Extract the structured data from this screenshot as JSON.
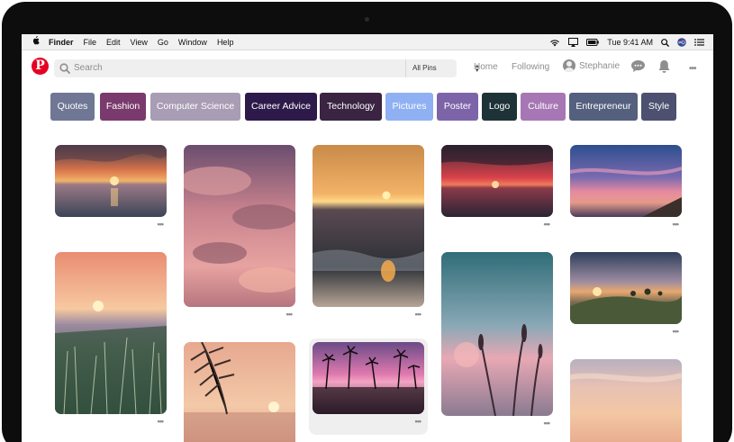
{
  "menubar": {
    "app_name": "Finder",
    "menus": [
      "File",
      "Edit",
      "View",
      "Go",
      "Window",
      "Help"
    ],
    "clock": "Tue 9:41 AM"
  },
  "header": {
    "logo_letter": "P",
    "search_placeholder": "Search",
    "search_filter": "All Pins",
    "nav_home": "Home",
    "nav_following": "Following",
    "user_name": "Stephanie",
    "more_dots": "•••"
  },
  "chips": [
    {
      "label": "Quotes",
      "color": "#6f7795"
    },
    {
      "label": "Fashion",
      "color": "#7a3a6d"
    },
    {
      "label": "Computer Science",
      "color": "#a89db4"
    },
    {
      "label": "Career Advice",
      "color": "#2e1a4a"
    },
    {
      "label": "Technology",
      "color": "#3a2442"
    },
    {
      "label": "Pictures",
      "color": "#8fb0f2"
    },
    {
      "label": "Poster",
      "color": "#7d64a9"
    },
    {
      "label": "Logo",
      "color": "#1e3338"
    },
    {
      "label": "Culture",
      "color": "#a677b4"
    },
    {
      "label": "Entrepreneur",
      "color": "#54607e"
    },
    {
      "label": "Style",
      "color": "#4e5070"
    }
  ],
  "pin_more": "•••",
  "pins": [
    {
      "scene": "sea-sunset-orange"
    },
    {
      "scene": "pink-clouds"
    },
    {
      "scene": "golden-sea-sunset"
    },
    {
      "scene": "red-sea-sunset"
    },
    {
      "scene": "blue-pink-sky-coast"
    },
    {
      "scene": "grass-field-sunset"
    },
    {
      "scene": "palm-leaf-sunset"
    },
    {
      "scene": "palm-silhouettes-pink"
    },
    {
      "scene": "blurred-grass-teal"
    },
    {
      "scene": "misty-hill-sunset"
    },
    {
      "scene": "soft-pastel-sky"
    }
  ]
}
